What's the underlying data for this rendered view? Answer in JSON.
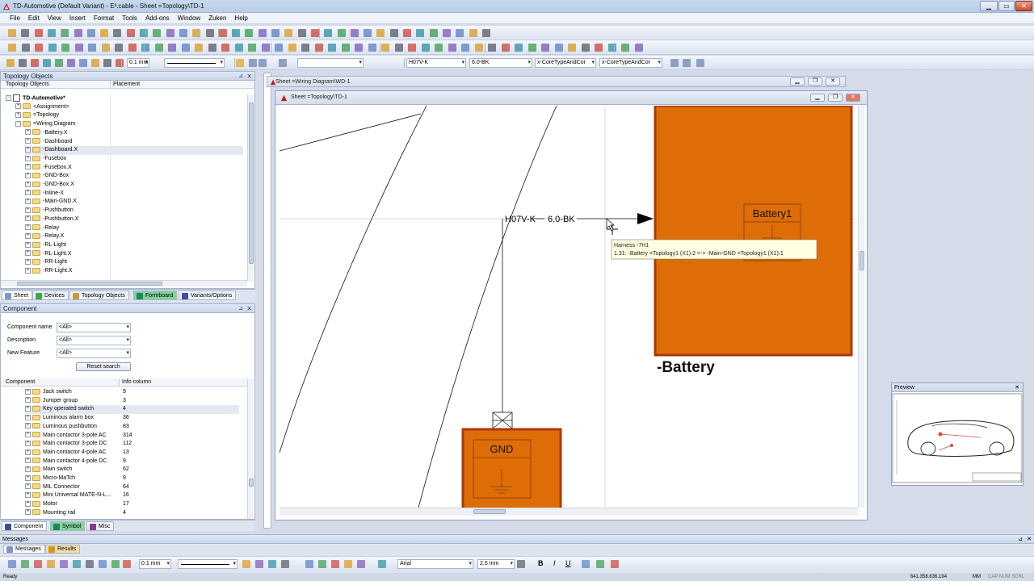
{
  "window": {
    "title": "TD-Automotive (Default Variant) - E³.cable - Sheet =Topology\\TD-1"
  },
  "menu": [
    "File",
    "Edit",
    "View",
    "Insert",
    "Format",
    "Tools",
    "Add-ons",
    "Window",
    "Zuken",
    "Help"
  ],
  "toolbar": {
    "line_width": "0.1 mm",
    "cable_type": "H07V-K",
    "wire_spec": "6.0-BK",
    "core_type_1": "x-CoreTypeAndCor",
    "core_type_2": "x-CoreTypeAndCor"
  },
  "topology_panel": {
    "title": "Topology Objects",
    "col_objects": "Topology Objects",
    "col_placement": "Placement",
    "items": [
      {
        "label": "TD-Automotive*",
        "level": 0,
        "bold": true
      },
      {
        "label": "<Assignment>",
        "level": 1
      },
      {
        "label": "=Topology",
        "level": 1
      },
      {
        "label": "=Wiring Diagram",
        "level": 1
      },
      {
        "label": "-Battery.X",
        "level": 2
      },
      {
        "label": "-Dashboard",
        "level": 2
      },
      {
        "label": "-Dashboard.X",
        "level": 2,
        "selected": true
      },
      {
        "label": "-Fusebox",
        "level": 2
      },
      {
        "label": "-Fusebox.X",
        "level": 2
      },
      {
        "label": "-GND-Box",
        "level": 2
      },
      {
        "label": "-GND-Box.X",
        "level": 2
      },
      {
        "label": "-Inline-X",
        "level": 2
      },
      {
        "label": "-Main-GND.X",
        "level": 2
      },
      {
        "label": "-Pushbutton",
        "level": 2
      },
      {
        "label": "-Pushbutton.X",
        "level": 2
      },
      {
        "label": "-Relay",
        "level": 2
      },
      {
        "label": "-Relay.X",
        "level": 2
      },
      {
        "label": "-RL-Light",
        "level": 2
      },
      {
        "label": "-RL-Light.X",
        "level": 2
      },
      {
        "label": "-RR-Light",
        "level": 2
      },
      {
        "label": "-RR-Light.X",
        "level": 2
      }
    ]
  },
  "left_tabs": [
    "Sheet",
    "Devices",
    "Topology Objects",
    "Formboard",
    "Variants/Options"
  ],
  "component_panel": {
    "title": "Component",
    "component_name_label": "Component name",
    "component_name_value": "<All>",
    "description_label": "Description",
    "description_value": "<All>",
    "new_feature_label": "New Feature",
    "new_feature_value": "<All>",
    "reset_label": "Reset search",
    "col_component": "Component",
    "col_info": "Info column",
    "rows": [
      {
        "name": "Jack switch",
        "info": "9"
      },
      {
        "name": "Jumper group",
        "info": "3"
      },
      {
        "name": "Key operated switch",
        "info": "4",
        "selected": true
      },
      {
        "name": "Luminous alarm box",
        "info": "36"
      },
      {
        "name": "Luminous pushbutton",
        "info": "83"
      },
      {
        "name": "Main contactor 3-pole AC",
        "info": "314"
      },
      {
        "name": "Main contactor 3-pole DC",
        "info": "112"
      },
      {
        "name": "Main contactor 4-pole AC",
        "info": "13"
      },
      {
        "name": "Main contactor 4-pole DC",
        "info": "9"
      },
      {
        "name": "Main switch",
        "info": "62"
      },
      {
        "name": "Micro-MaTch",
        "info": "9"
      },
      {
        "name": "MIL Connector",
        "info": "64"
      },
      {
        "name": "Mini Universal MATE-N-L...",
        "info": "16"
      },
      {
        "name": "Motor",
        "info": "17"
      },
      {
        "name": "Mounting rail",
        "info": "4"
      }
    ]
  },
  "bottom_tabs": [
    "Component",
    "Symbol",
    "Misc"
  ],
  "mdi": {
    "back_title": "Sheet =Wiring Diagram\\WD-1",
    "front_title": "Sheet =Topology\\TD-1"
  },
  "drawing": {
    "cable_label": "H07V-K",
    "wire_label": "6.0-BK",
    "battery_inner_label": "Battery1",
    "battery_name": "-Battery",
    "gnd_label": "GND",
    "tooltip_line1": "Harness -7H1",
    "tooltip_line2": "1.31: -Battery =Topology1 (X1):2 <-> -Main-GND =Topology1 (X1):1"
  },
  "preview": {
    "title": "Preview"
  },
  "messages": {
    "title": "Messages",
    "tab_messages": "Messages",
    "tab_results": "Results",
    "line_width": "0.1 mm",
    "font_name": "Arial",
    "font_size": "2.5 mm"
  },
  "status": {
    "left": "Ready",
    "coords": "641.358.836.194",
    "unit": "MM",
    "flags": "CAP NUM SCRL"
  },
  "colors": {
    "component_fill": "#de6d08",
    "component_border": "#a93a08",
    "accent": "#c7d9ef"
  }
}
